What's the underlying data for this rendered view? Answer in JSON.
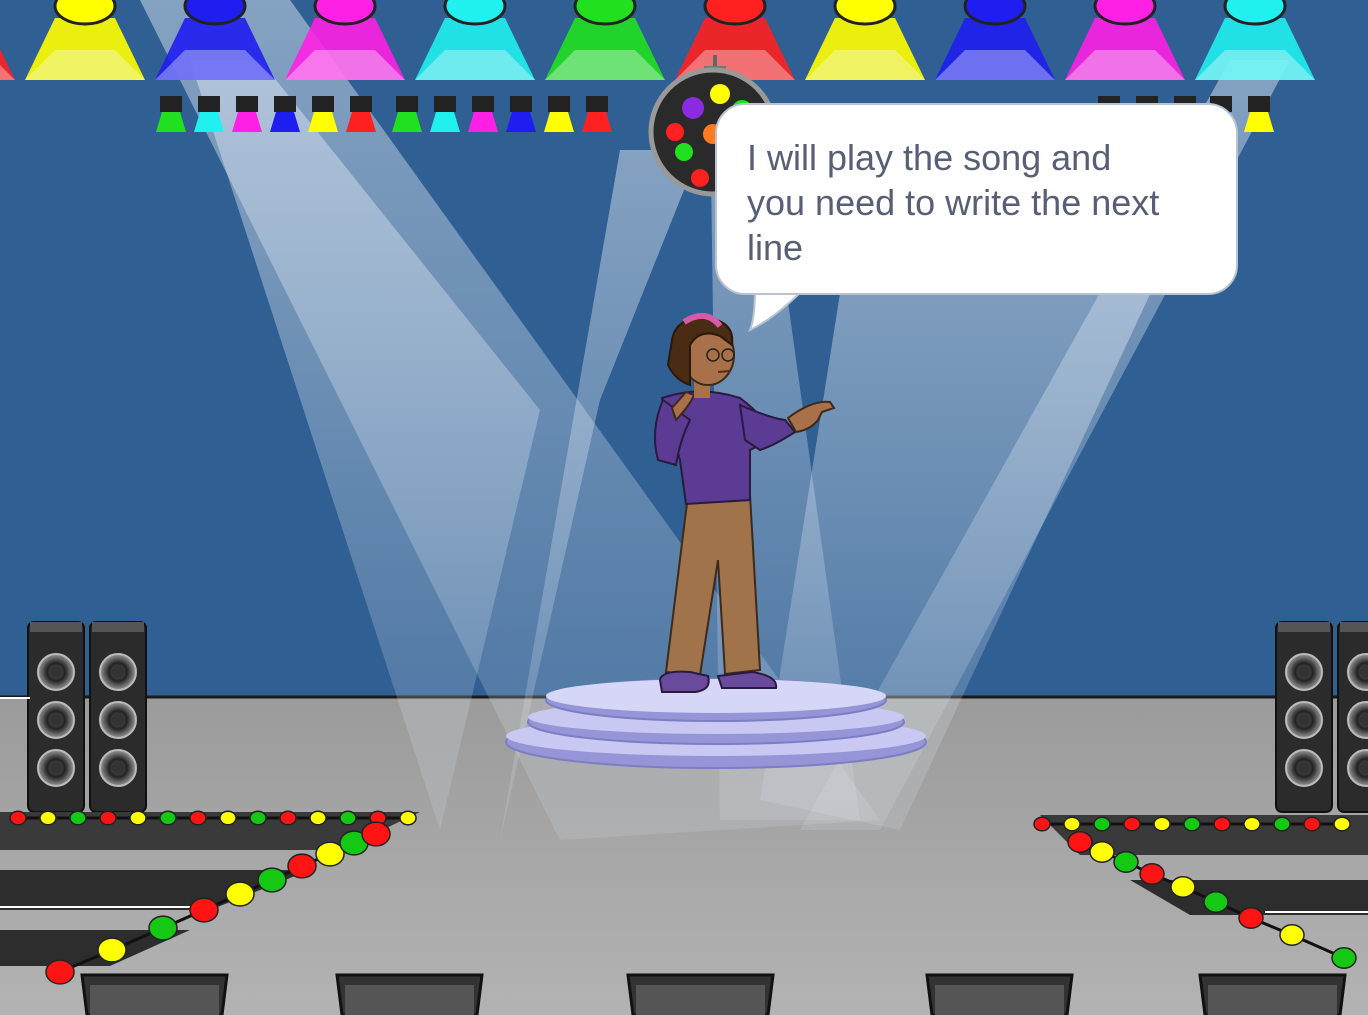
{
  "scene": {
    "backdrop": "concert-stage",
    "sprite": "dancer-girl",
    "colors": {
      "wall": "#2f5f93",
      "floor": "#a5a5a5",
      "spotlight": "#e6eef7",
      "platform": "#c8c8f2",
      "bubble_text": "#575e75",
      "bubble_border": "#b9c4d3"
    },
    "top_lights": [
      "#ff2020",
      "#ffff00",
      "#1e1ef0",
      "#ff20e6",
      "#20f0f0",
      "#20e020",
      "#ff2020",
      "#ffff00",
      "#1e1ef0",
      "#ff20e6",
      "#20f0f0"
    ],
    "small_lights": [
      "#20e020",
      "#20f0f0",
      "#ff20e6",
      "#1e1ef0",
      "#ffff00",
      "#ff2020",
      "#20e020",
      "#20f0f0",
      "#ff20e6",
      "#1e1ef0",
      "#ffff00",
      "#ff2020"
    ],
    "bulb_colors": [
      "#ff1414",
      "#ffff00",
      "#14c814"
    ]
  },
  "speech_bubble": {
    "lines": [
      "I will play the song and",
      "you need to write the next",
      "line"
    ]
  }
}
